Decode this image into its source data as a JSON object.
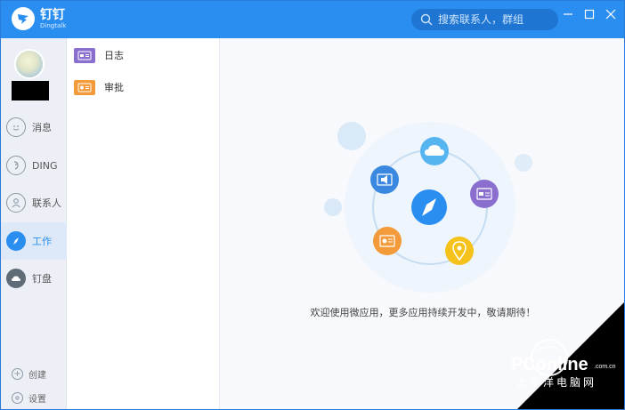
{
  "app": {
    "title_cn": "钉钉",
    "title_en": "Dingtalk"
  },
  "search": {
    "placeholder": "搜索联系人，群组"
  },
  "nav": {
    "items": [
      {
        "label": "消息",
        "icon": "message-icon"
      },
      {
        "label": "DING",
        "icon": "ding-icon"
      },
      {
        "label": "联系人",
        "icon": "contacts-icon"
      },
      {
        "label": "工作",
        "icon": "compass-icon"
      },
      {
        "label": "钉盘",
        "icon": "cloud-disk-icon"
      }
    ],
    "active": "工作",
    "bottom": [
      {
        "label": "创建",
        "icon": "plus-icon"
      },
      {
        "label": "设置",
        "icon": "gear-icon"
      }
    ]
  },
  "apps": [
    {
      "label": "日志",
      "icon": "log-icon",
      "color": "#8b6fcf"
    },
    {
      "label": "审批",
      "icon": "approval-icon",
      "color": "#f39a3a"
    }
  ],
  "main": {
    "message": "欢迎使用微应用，更多应用持续开发中，敬请期待！"
  },
  "watermark": {
    "brand": "PConline",
    "domain": ".com.cn",
    "tagline": "太平洋电脑网"
  },
  "colors": {
    "primary": "#2a8ef1",
    "purple": "#8b6fcf",
    "orange": "#f39a3a",
    "yellow": "#f4c21b",
    "cloud": "#56b4f0"
  }
}
